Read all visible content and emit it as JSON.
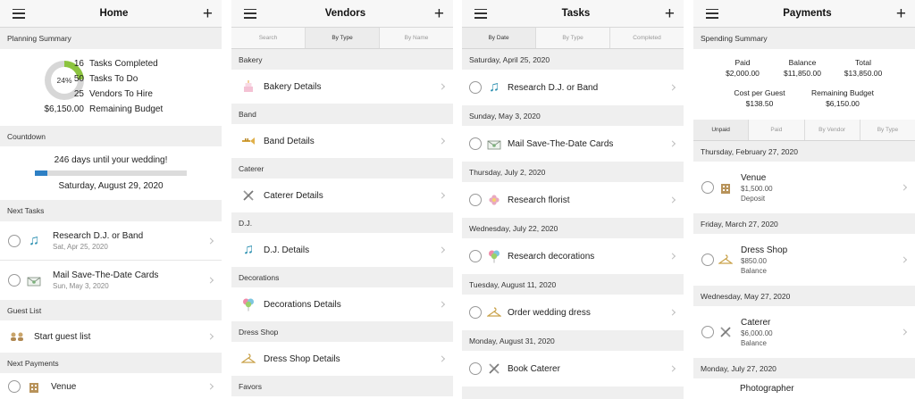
{
  "home": {
    "title": "Home",
    "planning_header": "Planning Summary",
    "donut_label": "24%",
    "summary": [
      {
        "n": "16",
        "label": "Tasks Completed"
      },
      {
        "n": "50",
        "label": "Tasks To Do"
      },
      {
        "n": "25",
        "label": "Vendors To Hire"
      },
      {
        "n": "$6,150.00",
        "label": "Remaining Budget"
      }
    ],
    "countdown_header": "Countdown",
    "days_text": "246 days until your wedding!",
    "wedding_date": "Saturday, August 29, 2020",
    "progress": 0.08,
    "next_tasks_header": "Next Tasks",
    "tasks": [
      {
        "title": "Research D.J. or Band",
        "date": "Sat, Apr 25, 2020",
        "icon": "music-note-icon"
      },
      {
        "title": "Mail Save-The-Date Cards",
        "date": "Sun, May 3, 2020",
        "icon": "envelope-icon"
      }
    ],
    "guest_header": "Guest List",
    "guest_action": "Start guest list",
    "payments_header": "Next Payments",
    "payment_venue": "Venue"
  },
  "vendors": {
    "title": "Vendors",
    "tabs": [
      "Search",
      "By Type",
      "By Name"
    ],
    "groups": [
      {
        "section": "Bakery",
        "item": "Bakery Details",
        "icon": "cake-icon"
      },
      {
        "section": "Band",
        "item": "Band Details",
        "icon": "trumpet-icon"
      },
      {
        "section": "Caterer",
        "item": "Caterer Details",
        "icon": "utensils-icon"
      },
      {
        "section": "D.J.",
        "item": "D.J. Details",
        "icon": "music-note-icon"
      },
      {
        "section": "Decorations",
        "item": "Decorations Details",
        "icon": "balloons-icon"
      },
      {
        "section": "Dress Shop",
        "item": "Dress Shop Details",
        "icon": "hanger-icon"
      }
    ],
    "last_section": "Favors"
  },
  "tasks": {
    "title": "Tasks",
    "tabs": [
      "By Date",
      "By Type",
      "Completed"
    ],
    "groups": [
      {
        "date": "Saturday, April 25, 2020",
        "item": "Research D.J. or Band",
        "icon": "music-note-icon"
      },
      {
        "date": "Sunday, May 3, 2020",
        "item": "Mail Save-The-Date Cards",
        "icon": "envelope-icon"
      },
      {
        "date": "Thursday, July 2, 2020",
        "item": "Research florist",
        "icon": "flower-icon"
      },
      {
        "date": "Wednesday, July 22, 2020",
        "item": "Research decorations",
        "icon": "balloons-icon"
      },
      {
        "date": "Tuesday, August 11, 2020",
        "item": "Order wedding dress",
        "icon": "hanger-icon"
      },
      {
        "date": "Monday, August 31, 2020",
        "item": "Book Caterer",
        "icon": "utensils-icon"
      }
    ]
  },
  "payments": {
    "title": "Payments",
    "summary_header": "Spending Summary",
    "paid_label": "Paid",
    "paid": "$2,000.00",
    "balance_label": "Balance",
    "balance": "$11,850.00",
    "total_label": "Total",
    "total": "$13,850.00",
    "cpg_label": "Cost per Guest",
    "cpg": "$138.50",
    "remaining_label": "Remaining Budget",
    "remaining": "$6,150.00",
    "tabs": [
      "Unpaid",
      "Paid",
      "By Vendor",
      "By Type"
    ],
    "groups": [
      {
        "date": "Thursday, February 27, 2020",
        "name": "Venue",
        "amount": "$1,500.00",
        "type": "Deposit",
        "icon": "building-icon"
      },
      {
        "date": "Friday, March 27, 2020",
        "name": "Dress Shop",
        "amount": "$850.00",
        "type": "Balance",
        "icon": "hanger-icon"
      },
      {
        "date": "Wednesday, May 27, 2020",
        "name": "Caterer",
        "amount": "$6,000.00",
        "type": "Balance",
        "icon": "utensils-icon"
      }
    ],
    "last_date": "Monday, July 27, 2020",
    "last_name": "Photographer"
  }
}
